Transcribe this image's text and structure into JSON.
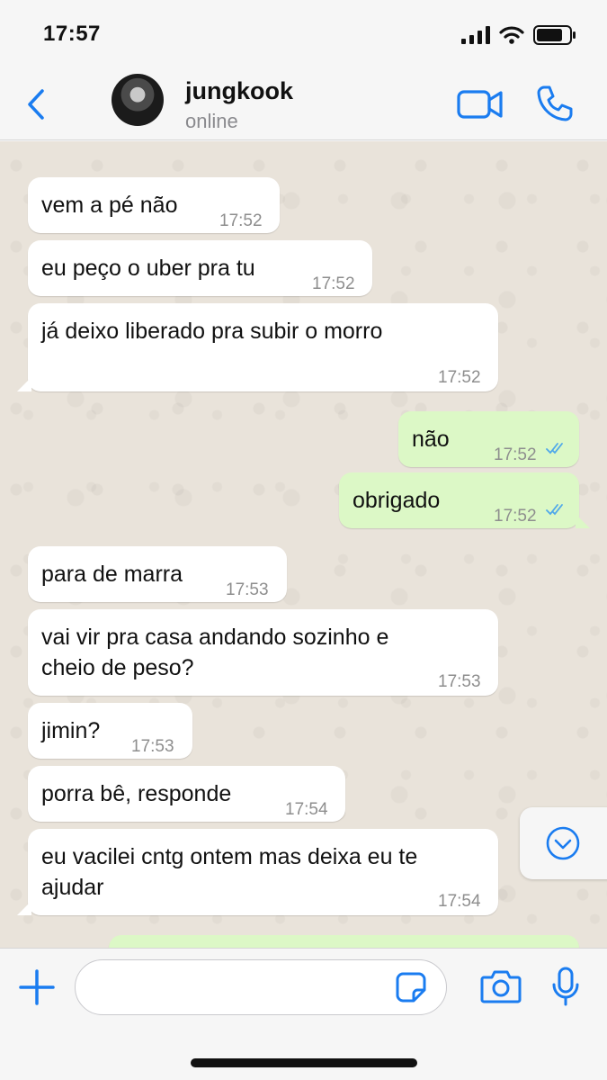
{
  "status_bar": {
    "time": "17:57"
  },
  "header": {
    "contact_name": "jungkook",
    "contact_status": "online"
  },
  "messages": [
    {
      "direction": "in",
      "text": "vem a pé não",
      "time": "17:52"
    },
    {
      "direction": "in",
      "text": "eu peço o uber pra tu",
      "time": "17:52"
    },
    {
      "direction": "in",
      "text": "já deixo liberado pra subir o morro",
      "time": "17:52"
    },
    {
      "direction": "out",
      "text": "não",
      "time": "17:52",
      "read": true
    },
    {
      "direction": "out",
      "text": "obrigado",
      "time": "17:52",
      "read": true
    },
    {
      "direction": "in",
      "text": "para de marra",
      "time": "17:53"
    },
    {
      "direction": "in",
      "text": "vai vir pra casa andando sozinho e",
      "text2": "cheio de peso?",
      "time": "17:53"
    },
    {
      "direction": "in",
      "text": "jimin?",
      "time": "17:53"
    },
    {
      "direction": "in",
      "text": "porra bê, responde",
      "time": "17:54"
    },
    {
      "direction": "in",
      "text": "eu vacilei cntg ontem mas deixa eu te",
      "text2": "ajudar",
      "time": "17:54"
    }
  ],
  "input": {
    "placeholder": ""
  },
  "colors": {
    "accent": "#1a7cf0",
    "incoming": "#ffffff",
    "outgoing": "#dcf8c6",
    "wallpaper": "#e9e3da"
  },
  "icons": [
    "back-chevron-icon",
    "video-camera-icon",
    "phone-icon",
    "plus-icon",
    "sticker-icon",
    "camera-icon",
    "microphone-icon",
    "chevron-down-circle-icon",
    "read-ticks-icon"
  ]
}
